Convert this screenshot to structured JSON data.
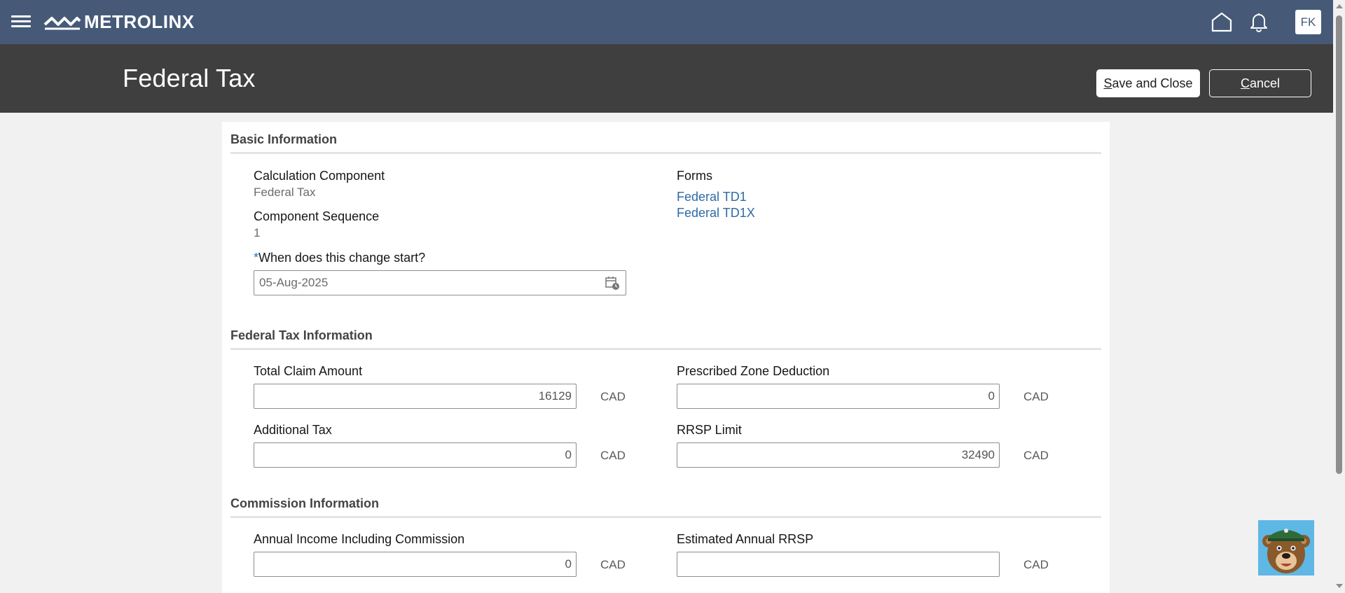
{
  "topbar": {
    "logo_text": "METROLINX",
    "avatar_initials": "FK",
    "icons": [
      "hamburger-menu-icon",
      "home-icon",
      "bell-icon"
    ],
    "color": "#465a78"
  },
  "header": {
    "title": "Federal Tax",
    "save_label_first": "S",
    "save_label_rest": "ave and Close",
    "cancel_label_first": "C",
    "cancel_label_rest": "ancel",
    "color": "#3f3f3f"
  },
  "basic": {
    "section_title": "Basic Information",
    "calc_component_label": "Calculation Component",
    "calc_component_value": "Federal Tax",
    "component_sequence_label": "Component Sequence",
    "component_sequence_value": "1",
    "change_start_required": "*",
    "change_start_label": "When does this change start?",
    "change_start_value": "05-Aug-2025",
    "forms_label": "Forms",
    "forms": [
      "Federal TD1",
      "Federal TD1X"
    ]
  },
  "federal": {
    "section_title": "Federal Tax Information",
    "total_claim_label": "Total Claim Amount",
    "total_claim_value": "16129",
    "prescribed_zone_label": "Prescribed Zone Deduction",
    "prescribed_zone_value": "0",
    "additional_tax_label": "Additional Tax",
    "additional_tax_value": "0",
    "rrsp_limit_label": "RRSP Limit",
    "rrsp_limit_value": "32490",
    "currency": "CAD"
  },
  "commission": {
    "section_title": "Commission Information",
    "annual_income_label": "Annual Income Including Commission",
    "annual_income_value": "0",
    "estimated_rrsp_label": "Estimated Annual RRSP",
    "estimated_rrsp_value": "",
    "currency": "CAD"
  }
}
